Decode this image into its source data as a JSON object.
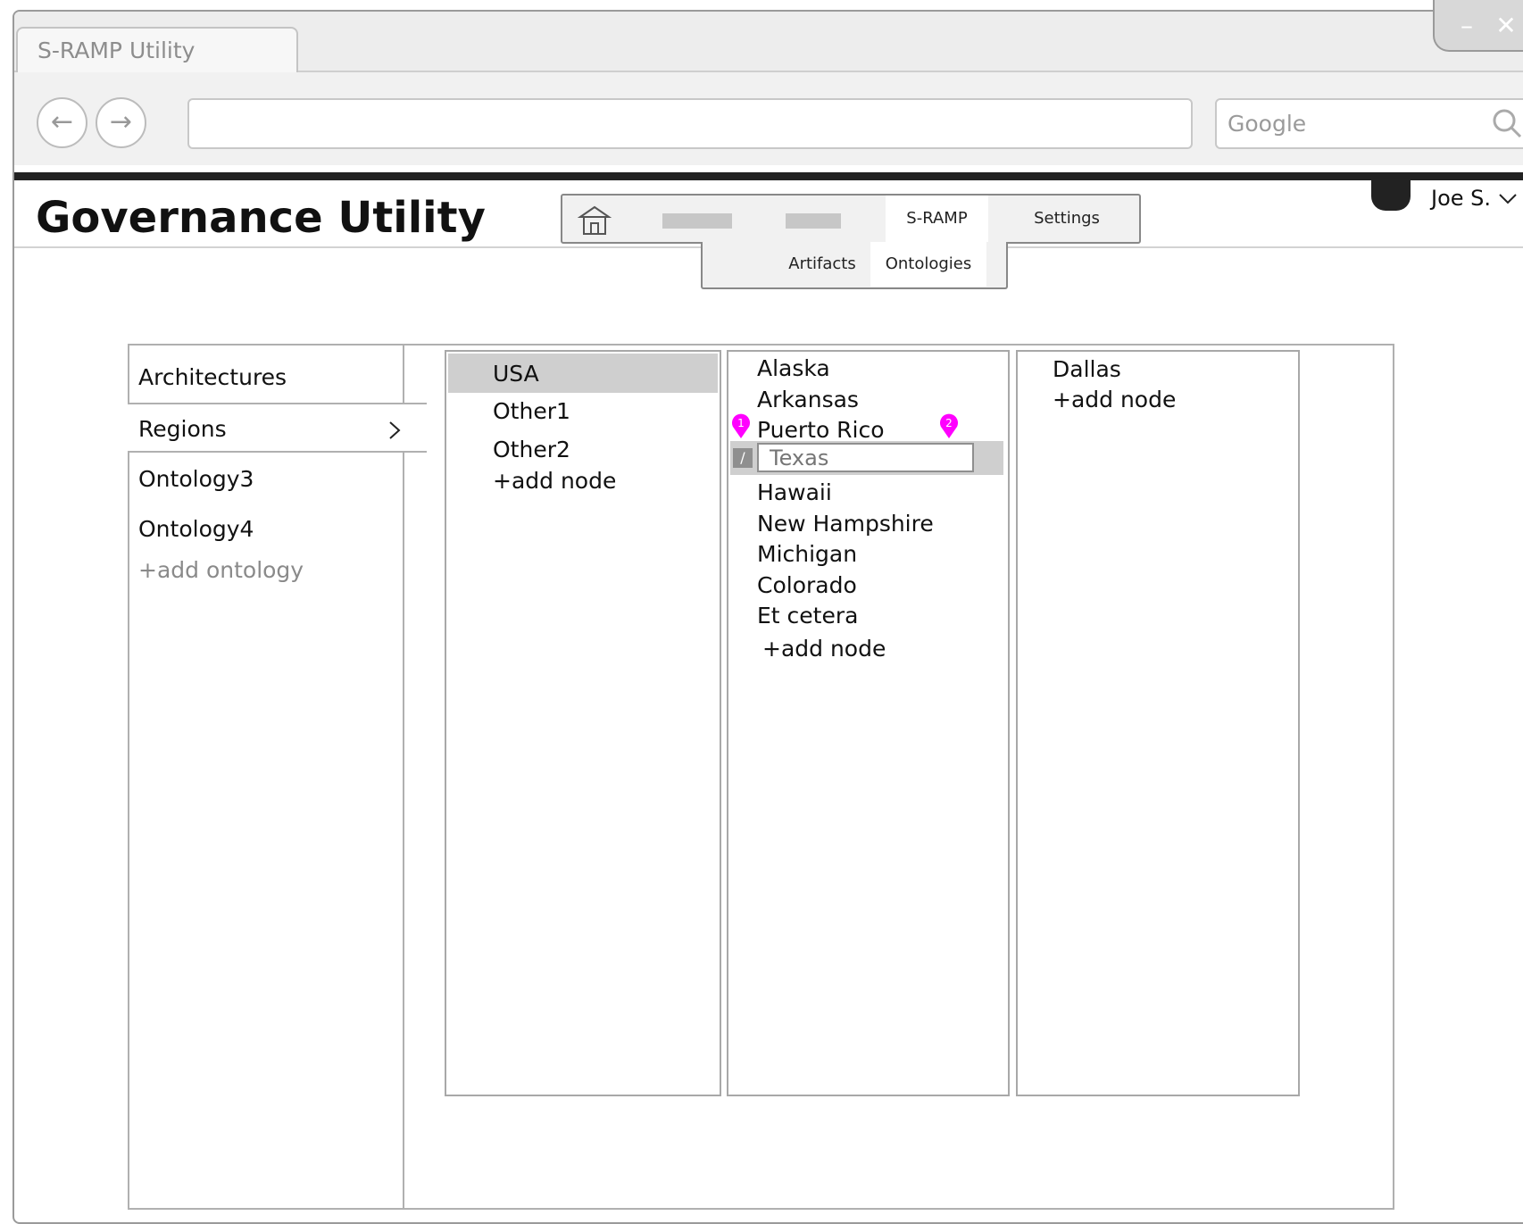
{
  "browser": {
    "tab_title": "S-RAMP Utility",
    "minimize_label": "–",
    "close_label": "✕",
    "back_glyph": "←",
    "forward_glyph": "→",
    "search_placeholder": "Google"
  },
  "app": {
    "title": "Governance Utility",
    "user_label": "Joe S."
  },
  "main_nav": {
    "items": [
      {
        "label": "S-RAMP",
        "active": true
      },
      {
        "label": "Settings",
        "active": false
      }
    ]
  },
  "sub_nav": {
    "items": [
      {
        "label": "Artifacts",
        "active": false
      },
      {
        "label": "Ontologies",
        "active": true
      }
    ]
  },
  "ontologies": {
    "items": [
      "Architectures",
      "Regions",
      "Ontology3",
      "Ontology4"
    ],
    "selected": "Regions",
    "add_label": "+add ontology"
  },
  "columns": {
    "col1": {
      "items": [
        "USA",
        "Other1",
        "Other2"
      ],
      "selected": "USA",
      "add_label": "+add node"
    },
    "col2": {
      "items_before": [
        "Alaska",
        "Arkansas",
        "Puerto Rico"
      ],
      "editing_placeholder": "Texas",
      "items_after": [
        "Hawaii",
        "New Hampshire",
        "Michigan",
        "Colorado",
        "Et cetera"
      ],
      "add_label": "+add node",
      "markers": [
        "1",
        "2"
      ]
    },
    "col3": {
      "items": [
        "Dallas"
      ],
      "add_label": "+add node"
    }
  },
  "colors": {
    "marker": "#ff00ff",
    "selection": "#cfcfcf"
  }
}
